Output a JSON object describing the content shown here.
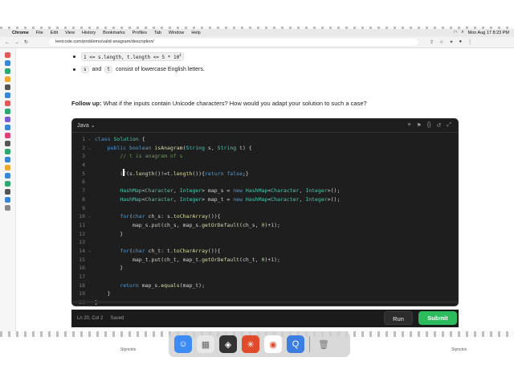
{
  "menubar": {
    "app": "Chrome",
    "items": [
      "File",
      "Edit",
      "View",
      "History",
      "Bookmarks",
      "Profiles",
      "Tab",
      "Window",
      "Help"
    ],
    "clock": "Mon Aug 17  8:23 PM"
  },
  "browser": {
    "url": "leetcode.com/problems/valid-anagram/description/"
  },
  "problem": {
    "constraint_1": "1 <= s.length, t.length <= 5 * 10",
    "constraint_1_sup": "4",
    "constraint_2_s": "s",
    "constraint_2_and": "and",
    "constraint_2_t": "t",
    "constraint_2_rest": "consist of lowercase English letters.",
    "followup_label": "Follow up:",
    "followup_text": "What if the inputs contain Unicode characters? How would you adapt your solution to such a case?"
  },
  "editor": {
    "language": "Java",
    "tool_icons": [
      "format-icon",
      "bookmark-icon",
      "braces-icon",
      "reset-icon",
      "expand-icon"
    ],
    "line_numbers": [
      "1",
      "2",
      "3",
      "4",
      "5",
      "6",
      "7",
      "8",
      "9",
      "10",
      "11",
      "12",
      "13",
      "14",
      "15",
      "16",
      "17",
      "18",
      "19",
      "20"
    ]
  },
  "status": {
    "position": "Ln 20, Col 2",
    "saved": "Saved",
    "run_label": "Run",
    "submit_label": "Submit"
  },
  "watermark": "Stynctrix",
  "colors": {
    "submit": "#2cbb5d",
    "editor_bg": "#1e1e1e"
  }
}
